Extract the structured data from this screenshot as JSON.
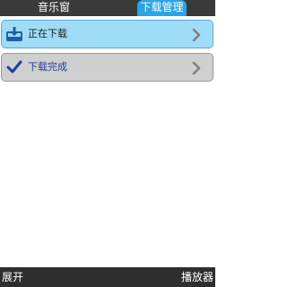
{
  "tabs": {
    "music": "音乐窗",
    "downloads": "下载管理"
  },
  "list": {
    "items": [
      {
        "label": "正在下载",
        "icon": "download-box-icon",
        "selected": true
      },
      {
        "label": "下载完成",
        "icon": "checkmark-icon",
        "selected": false
      }
    ]
  },
  "softkeys": {
    "left": "展开",
    "right": "播放器"
  },
  "colors": {
    "selected_row": "#9fdcf8",
    "normal_row": "#cfcfcf",
    "active_tab": "#2aa3e8",
    "bar_dark": "#2e2e2e"
  }
}
